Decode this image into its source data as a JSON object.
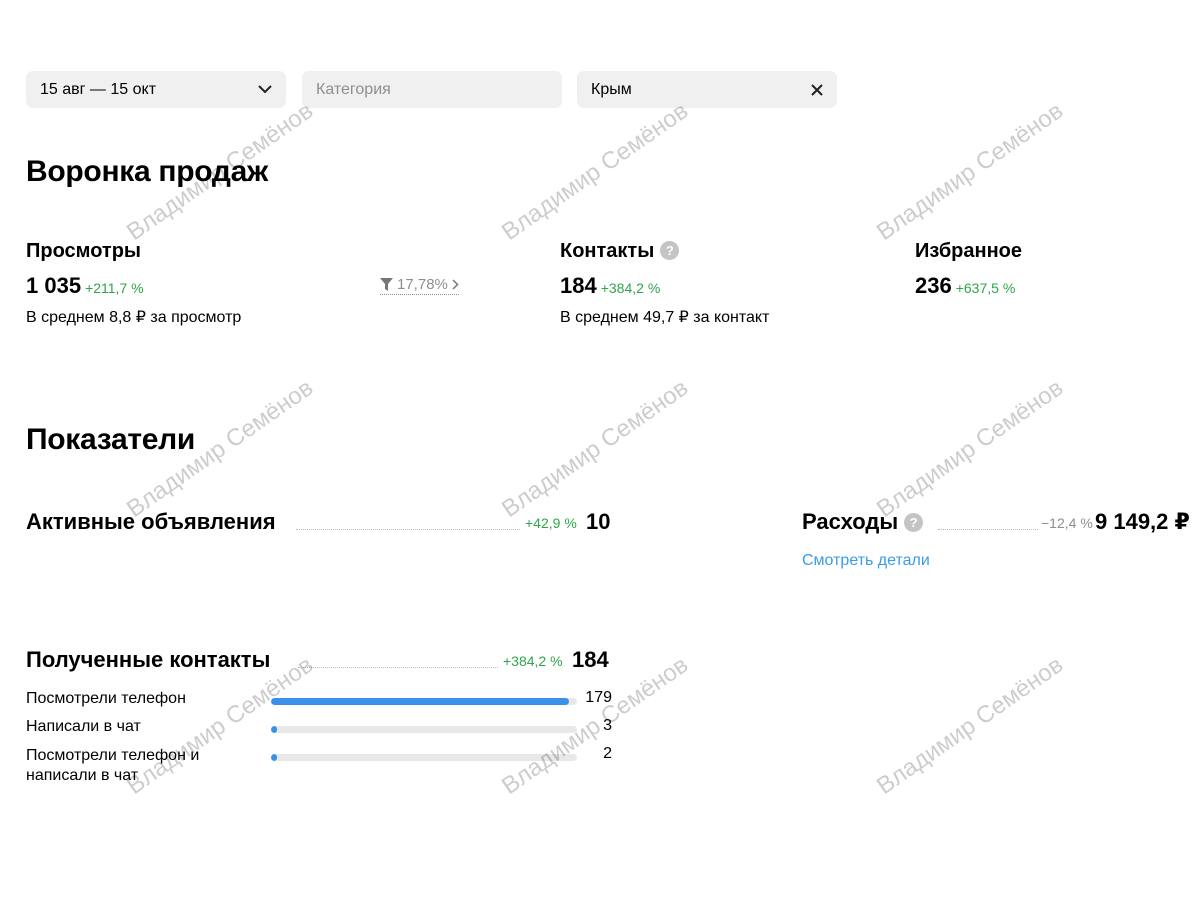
{
  "filters": {
    "date_range": "15 авг — 15 окт",
    "category_placeholder": "Категория",
    "region": "Крым"
  },
  "funnel": {
    "title": "Воронка продаж",
    "views": {
      "title": "Просмотры",
      "value": "1 035",
      "delta": "+211,7 %",
      "average": "В среднем 8,8 ₽ за просмотр",
      "conversion": "17,78%"
    },
    "contacts": {
      "title": "Контакты",
      "value": "184",
      "delta": "+384,2 %",
      "average": "В среднем 49,7 ₽ за контакт"
    },
    "favorites": {
      "title": "Избранное",
      "value": "236",
      "delta": "+637,5 %"
    }
  },
  "metrics": {
    "title": "Показатели",
    "active_ads": {
      "title": "Активные объявления",
      "delta": "+42,9 %",
      "value": "10"
    },
    "expenses": {
      "title": "Расходы",
      "delta": "−12,4 %",
      "value": "9 149,2 ₽",
      "details_link": "Смотреть детали"
    }
  },
  "received_contacts": {
    "title": "Полученные контакты",
    "delta": "+384,2 %",
    "value": "184",
    "rows": [
      {
        "label": "Посмотрели телефон",
        "value": "179",
        "share": 0.973
      },
      {
        "label": "Написали в чат",
        "value": "3",
        "share": 0.016
      },
      {
        "label": "Посмотрели телефон и написали в чат",
        "value": "2",
        "share": 0.011
      }
    ]
  },
  "watermark": "Владимир Семёнов",
  "colors": {
    "accent_blue": "#3a91ea",
    "link_blue": "#3a9ce6",
    "positive_green": "#2ea64a",
    "muted_gray": "#8f8f8f",
    "field_bg": "#f0f0f0"
  },
  "icons": {
    "date_dropdown": "chevron-down-icon",
    "region_clear": "close-icon",
    "conversion": "filter-funnel-icon",
    "conversion_more": "chevron-right-icon",
    "help": "question-circle-icon"
  }
}
